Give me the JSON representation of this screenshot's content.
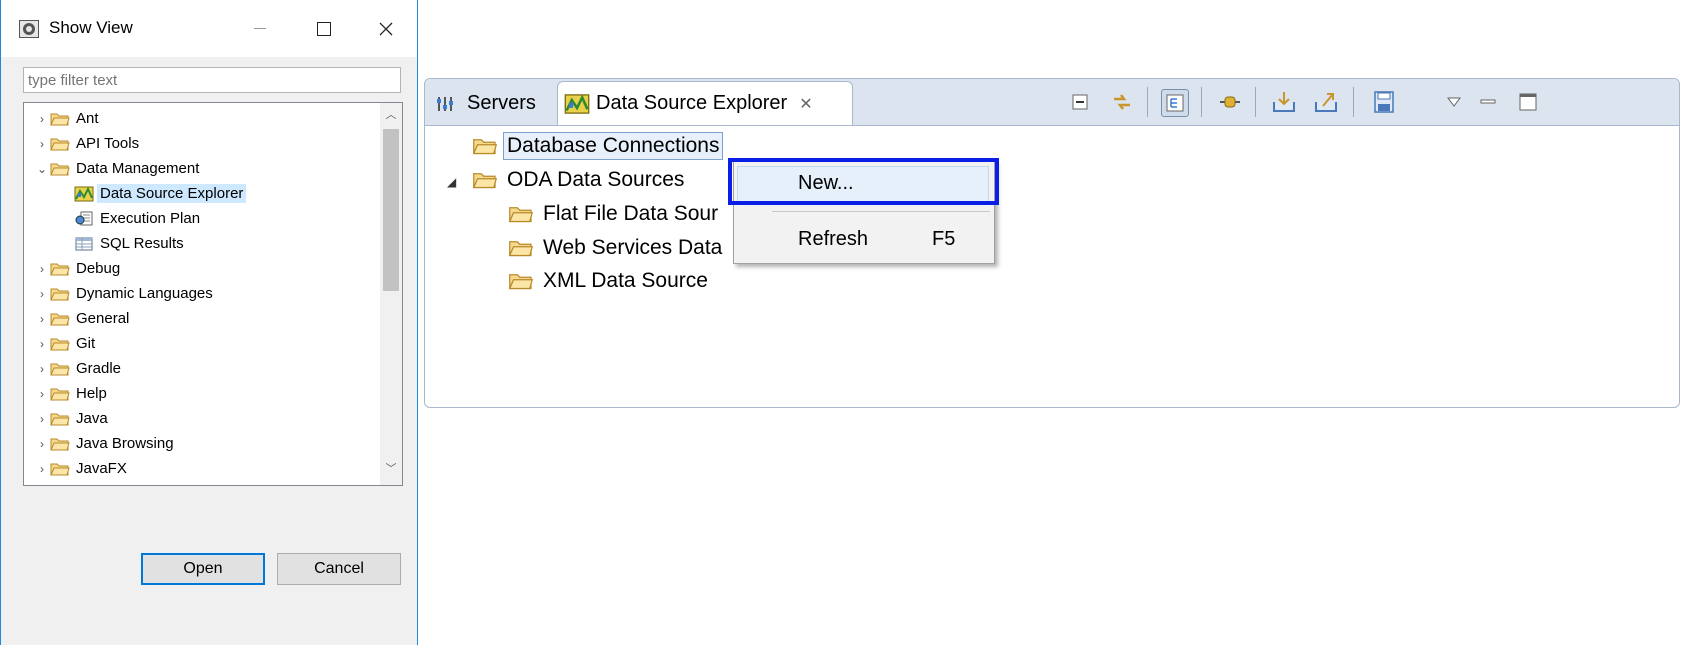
{
  "dialog": {
    "title": "Show View",
    "filter_placeholder": "type filter text",
    "tree": [
      {
        "label": "Ant",
        "level": 0,
        "expanded": false,
        "icon": "folder-icon"
      },
      {
        "label": "API Tools",
        "level": 0,
        "expanded": false,
        "icon": "folder-icon"
      },
      {
        "label": "Data Management",
        "level": 0,
        "expanded": true,
        "icon": "folder-icon"
      },
      {
        "label": "Data Source Explorer",
        "level": 1,
        "selected": true,
        "icon": "data-source-explorer-icon"
      },
      {
        "label": "Execution Plan",
        "level": 1,
        "icon": "execution-plan-icon"
      },
      {
        "label": "SQL Results",
        "level": 1,
        "icon": "sql-results-icon"
      },
      {
        "label": "Debug",
        "level": 0,
        "expanded": false,
        "icon": "folder-icon"
      },
      {
        "label": "Dynamic Languages",
        "level": 0,
        "expanded": false,
        "icon": "folder-icon"
      },
      {
        "label": "General",
        "level": 0,
        "expanded": false,
        "icon": "folder-icon"
      },
      {
        "label": "Git",
        "level": 0,
        "expanded": false,
        "icon": "folder-icon"
      },
      {
        "label": "Gradle",
        "level": 0,
        "expanded": false,
        "icon": "folder-icon"
      },
      {
        "label": "Help",
        "level": 0,
        "expanded": false,
        "icon": "folder-icon"
      },
      {
        "label": "Java",
        "level": 0,
        "expanded": false,
        "icon": "folder-icon"
      },
      {
        "label": "Java Browsing",
        "level": 0,
        "expanded": false,
        "icon": "folder-icon"
      },
      {
        "label": "JavaFX",
        "level": 0,
        "expanded": false,
        "icon": "folder-icon"
      }
    ],
    "open_label": "Open",
    "cancel_label": "Cancel"
  },
  "view": {
    "tabs": [
      {
        "label": "Servers",
        "icon": "servers-icon"
      },
      {
        "label": "Data Source Explorer",
        "icon": "data-source-explorer-icon",
        "active": true
      }
    ],
    "tree": [
      {
        "label": "Database Connections",
        "selected": true
      },
      {
        "label": "ODA Data Sources",
        "expanded": true
      },
      {
        "label": "Flat File Data Sour"
      },
      {
        "label": "Web Services Data"
      },
      {
        "label": "XML Data Source"
      }
    ]
  },
  "context_menu": {
    "items": [
      {
        "label": "New...",
        "shortcut": ""
      },
      {
        "label": "Refresh",
        "shortcut": "F5"
      }
    ]
  },
  "colors": {
    "highlight_box": "#0a1ee6",
    "selection": "#cde8ff",
    "tab_strip": "#dbe4ef",
    "folder": "#e8b94a"
  }
}
